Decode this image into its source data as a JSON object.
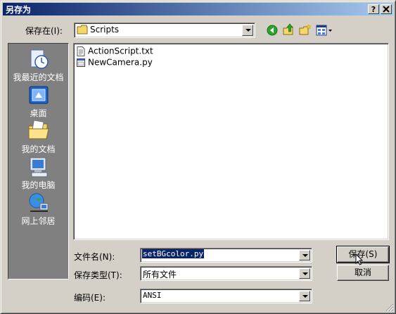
{
  "window": {
    "title": "另存为",
    "help_btn": "?",
    "close_btn": "X"
  },
  "toolbar": {
    "save_in_label": "保存在(I):",
    "folder": "Scripts",
    "icons": [
      "back-icon",
      "up-folder-icon",
      "new-folder-icon",
      "view-menu-icon"
    ]
  },
  "places": [
    {
      "label": "我最近的文档",
      "icon": "recent-documents-icon"
    },
    {
      "label": "桌面",
      "icon": "desktop-icon"
    },
    {
      "label": "我的文档",
      "icon": "my-documents-icon"
    },
    {
      "label": "我的电脑",
      "icon": "my-computer-icon"
    },
    {
      "label": "网上邻居",
      "icon": "network-places-icon"
    }
  ],
  "files": [
    {
      "name": "ActionScript.txt",
      "icon": "text-file-icon"
    },
    {
      "name": "NewCamera.py",
      "icon": "python-file-icon"
    }
  ],
  "form": {
    "filename_label": "文件名(N):",
    "filename_value": "setBGcolor.py",
    "type_label": "保存类型(T):",
    "type_value": "所有文件",
    "encoding_label": "编码(E):",
    "encoding_value": "ANSI"
  },
  "buttons": {
    "save": "保存(S)",
    "cancel": "取消"
  },
  "colors": {
    "title_start": "#0a246a",
    "title_end": "#a6caf0",
    "places_bg": "#808080",
    "selection": "#0a246a"
  }
}
